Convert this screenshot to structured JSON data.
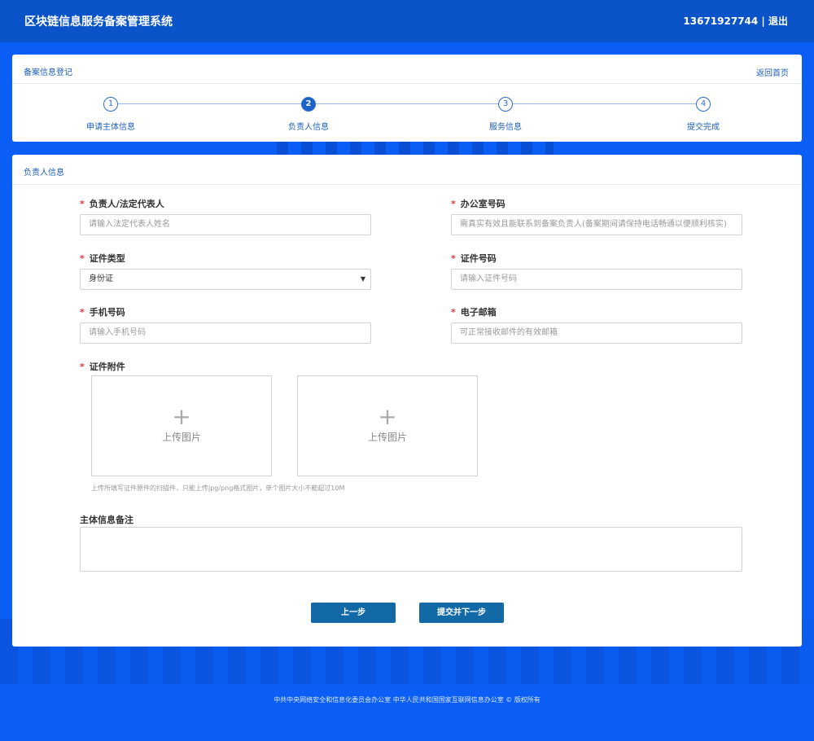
{
  "header": {
    "title": "区块链信息服务备案管理系统",
    "user": "13671927744 | 退出"
  },
  "steps_card": {
    "title": "备案信息登记",
    "back_label": "返回首页",
    "steps": [
      {
        "number": "1",
        "label": "申请主体信息",
        "active": false
      },
      {
        "number": "2",
        "label": "负责人信息",
        "active": true
      },
      {
        "number": "3",
        "label": "服务信息",
        "active": false
      },
      {
        "number": "4",
        "label": "提交完成",
        "active": false
      }
    ]
  },
  "form_card": {
    "title": "负责人信息",
    "fields": {
      "legal_rep": {
        "label": "负责人/法定代表人",
        "placeholder": "请输入法定代表人姓名"
      },
      "office_phone": {
        "label": "办公室号码",
        "placeholder": "需真实有效且能联系到备案负责人(备案期间请保持电话畅通以便顺利核实)"
      },
      "id_type": {
        "label": "证件类型",
        "value": "身份证"
      },
      "id_number": {
        "label": "证件号码",
        "placeholder": "请输入证件号码"
      },
      "mobile": {
        "label": "手机号码",
        "placeholder": "请输入手机号码"
      },
      "email": {
        "label": "电子邮箱",
        "placeholder": "可正常接收邮件的有效邮箱"
      },
      "attachment": {
        "label": "证件附件"
      }
    },
    "upload_label": "上传图片",
    "upload_hint": "上传所填写证件原件的扫描件，只能上传jpg/png格式图片，单个图片大小不能超过10M",
    "remark_label": "主体信息备注",
    "prev_button": "上一步",
    "next_button": "提交并下一步"
  },
  "footer": "中共中央网络安全和信息化委员会办公室    中华人民共和国国家互联网信息办公室 © 版权所有",
  "colors": {
    "background": "#0a5ef5",
    "topbar": "#0b53c9",
    "button": "#1269a6",
    "required": "#d9383e"
  }
}
